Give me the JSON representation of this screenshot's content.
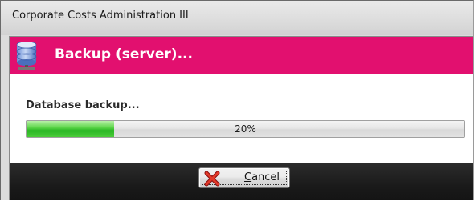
{
  "window": {
    "title": "Corporate Costs Administration III"
  },
  "header": {
    "icon": "database-server-icon",
    "title": "Backup (server)...",
    "color": "#e2106f"
  },
  "status": {
    "text": "Database backup..."
  },
  "progress": {
    "value": 0.2,
    "label": "20%",
    "color": "#2ab624"
  },
  "buttons": {
    "cancel": {
      "icon": "red-x-icon",
      "mnemonic": "C",
      "rest": "ancel"
    }
  }
}
